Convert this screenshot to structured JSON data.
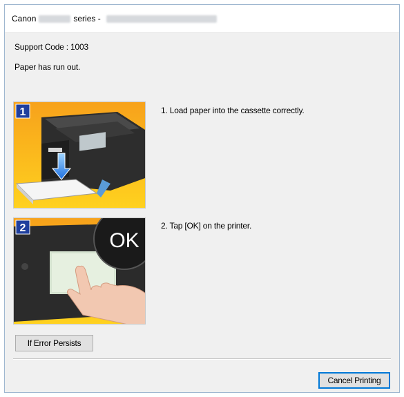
{
  "window": {
    "title_prefix": "Canon",
    "title_series": "series -"
  },
  "message": {
    "support_code": "Support Code : 1003",
    "text": "Paper has run out."
  },
  "steps": [
    {
      "number": "1",
      "instruction": "1.   Load paper into the cassette correctly.",
      "illustration": "printer-cassette-load-paper"
    },
    {
      "number": "2",
      "instruction": "2.   Tap [OK] on the printer.",
      "illustration": "finger-tapping-ok",
      "bubble_text": "OK"
    }
  ],
  "buttons": {
    "if_error_persists": "If Error Persists",
    "cancel_printing": "Cancel Printing"
  },
  "colors": {
    "accent": "#0078d7",
    "step_badge": "#1f3f9e",
    "illustration_yellow": "#ffd21f",
    "illustration_orange": "#f7a21b"
  }
}
